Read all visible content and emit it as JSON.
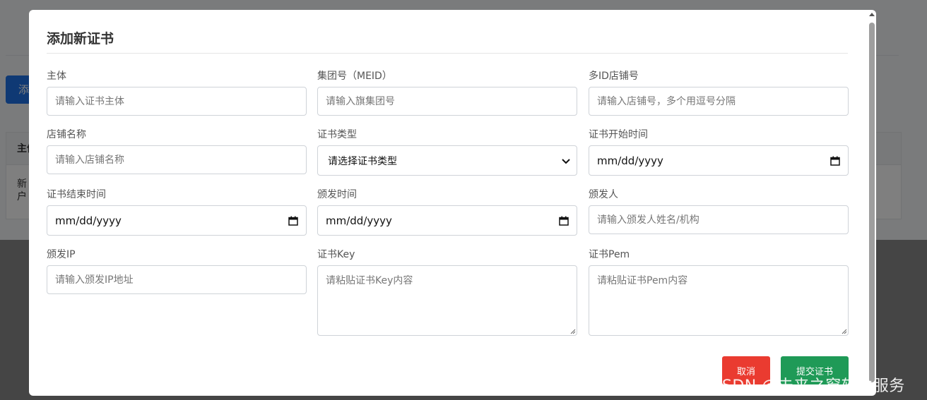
{
  "background": {
    "add_button_label": "添",
    "table_header_label": "主体",
    "table_cell_text": "新户"
  },
  "modal": {
    "title": "添加新证书",
    "fields": [
      {
        "label": "主体",
        "placeholder": "请输入证书主体",
        "type": "text"
      },
      {
        "label": "集团号（MEID）",
        "placeholder": "请输入旗集团号",
        "type": "text"
      },
      {
        "label": "多ID店铺号",
        "placeholder": "请输入店铺号，多个用逗号分隔",
        "type": "text"
      },
      {
        "label": "店铺名称",
        "placeholder": "请输入店铺名称",
        "type": "text"
      },
      {
        "label": "证书类型",
        "selected": "请选择证书类型",
        "type": "select"
      },
      {
        "label": "证书开始时间",
        "value": "mm/dd/yyyy",
        "type": "date"
      },
      {
        "label": "证书结束时间",
        "value": "mm/dd/yyyy",
        "type": "date"
      },
      {
        "label": "颁发时间",
        "value": "mm/dd/yyyy",
        "type": "date"
      },
      {
        "label": "颁发人",
        "placeholder": "请输入颁发人姓名/机构",
        "type": "text"
      },
      {
        "label": "颁发IP",
        "placeholder": "请输入颁发IP地址",
        "type": "text"
      },
      {
        "label": "证书Key",
        "placeholder": "请粘贴证书Key内容",
        "type": "textarea"
      },
      {
        "label": "证书Pem",
        "placeholder": "请粘贴证书Pem内容",
        "type": "textarea"
      }
    ],
    "cancel_label": "取消",
    "submit_label": "提交证书"
  },
  "watermark": "CSDN @未来之窗软件服务",
  "colors": {
    "cancel": "#ea3b30",
    "submit": "#1f9a57",
    "background_button": "#1e73e8"
  },
  "icons": {
    "date": "calendar-icon",
    "select": "chevron-down-icon"
  }
}
